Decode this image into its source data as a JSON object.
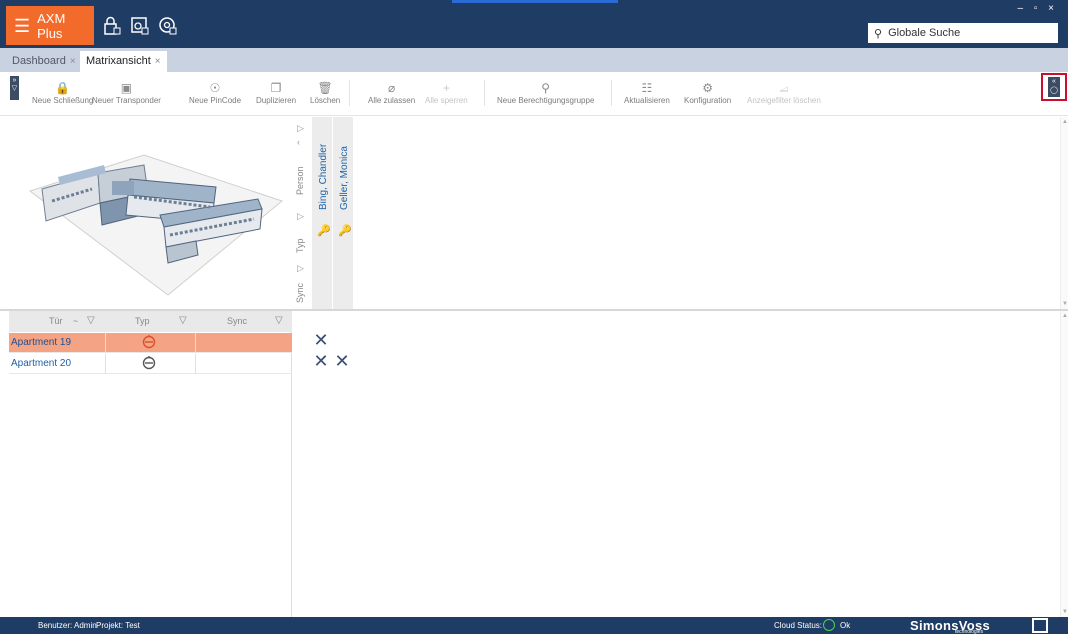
{
  "app": {
    "name": "AXM Plus",
    "window_controls": "– ▫ ×"
  },
  "header": {
    "search_label": "Globale Suche"
  },
  "tabs": [
    {
      "label": "Dashboard",
      "close": "×"
    },
    {
      "label": "Matrixansicht",
      "close": "×"
    }
  ],
  "toolbar": {
    "items": [
      {
        "label": "Neue Schließung",
        "icon": "lock-plus-icon",
        "enabled": true
      },
      {
        "label": "Neuer Transponder",
        "icon": "transponder-plus-icon",
        "enabled": true
      },
      {
        "label": "Neue PinCode",
        "icon": "pincode-plus-icon",
        "enabled": true
      },
      {
        "label": "Duplizieren",
        "icon": "duplicate-icon",
        "enabled": true
      },
      {
        "label": "Löschen",
        "icon": "trash-icon",
        "enabled": true
      },
      {
        "label": "Alle zulassen",
        "icon": "allow-all-icon",
        "enabled": true
      },
      {
        "label": "Alle sperren",
        "icon": "block-all-icon",
        "enabled": true
      },
      {
        "label": "Neue Berechtigungsgruppe",
        "icon": "permission-group-icon",
        "enabled": true
      },
      {
        "label": "Aktualisieren",
        "icon": "refresh-icon",
        "enabled": true
      },
      {
        "label": "Konfiguration",
        "icon": "gear-icon",
        "enabled": true
      },
      {
        "label": "Anzeigefilter löschen",
        "icon": "clear-filter-icon",
        "enabled": false
      }
    ]
  },
  "matrix_header": {
    "row_labels": [
      "Person",
      "Typ",
      "Sync"
    ],
    "persons": [
      {
        "name": "Bing, Chandler",
        "type_icon": "key-icon"
      },
      {
        "name": "Geller, Monica",
        "type_icon": "key-icon"
      }
    ]
  },
  "door_table": {
    "columns": [
      {
        "label": "Tür",
        "sort": "~"
      },
      {
        "label": "Typ"
      },
      {
        "label": "Sync"
      }
    ],
    "rows": [
      {
        "name": "Apartment 19",
        "type_icon": "lock-cylinder-icon",
        "selected": true
      },
      {
        "name": "Apartment 20",
        "type_icon": "lock-cylinder-icon",
        "selected": false
      }
    ]
  },
  "matrix": {
    "cells": [
      [
        true,
        false
      ],
      [
        true,
        true
      ]
    ],
    "mark": "✕"
  },
  "statusbar": {
    "user": "Benutzer: Admin",
    "project": "Projekt: Test",
    "cloud_status": "Cloud Status:",
    "cloud_value": "Ok",
    "brand": "SimonsVoss",
    "brand_sub": "technologies"
  },
  "colors": {
    "titlebar": "#1f3c64",
    "app_button": "#f26b2b",
    "selected_row": "#f4a384",
    "link_text": "#1e5fa6",
    "highlight_border": "#c8102e"
  }
}
